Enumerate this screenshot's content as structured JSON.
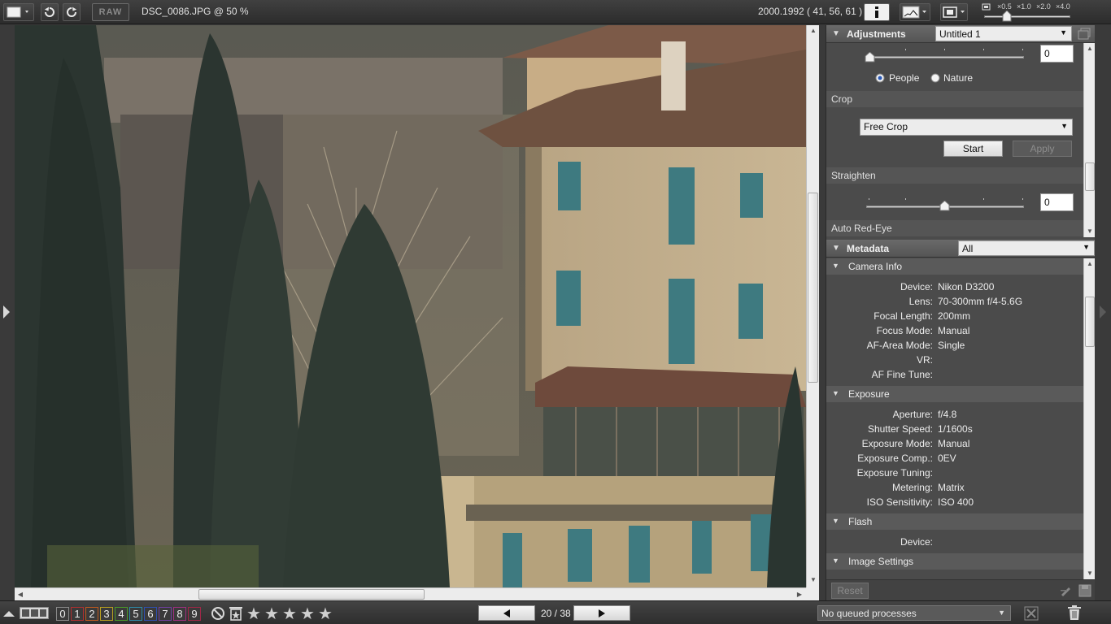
{
  "toolbar": {
    "raw_label": "RAW",
    "filename": "DSC_0086.JPG @ 50 %",
    "coords": "2000.1992 ( 41, 56, 61 )",
    "zoom_levels": [
      "×0.5",
      "×1.0",
      "×2.0",
      "×4.0"
    ]
  },
  "adjustments": {
    "title": "Adjustments",
    "preset": "Untitled 1",
    "slider_value": "0",
    "radio": [
      {
        "label": "People",
        "selected": true
      },
      {
        "label": "Nature",
        "selected": false
      }
    ],
    "crop_label": "Crop",
    "crop_mode": "Free Crop",
    "start_label": "Start",
    "apply_label": "Apply",
    "straighten_label": "Straighten",
    "straighten_value": "0",
    "red_eye_label": "Auto Red-Eye"
  },
  "metadata": {
    "title": "Metadata",
    "filter": "All",
    "camera_info": {
      "title": "Camera Info",
      "rows": [
        {
          "k": "Device:",
          "v": "Nikon D3200"
        },
        {
          "k": "Lens:",
          "v": "70-300mm f/4-5.6G"
        },
        {
          "k": "Focal Length:",
          "v": "200mm"
        },
        {
          "k": "Focus Mode:",
          "v": "Manual"
        },
        {
          "k": "AF-Area Mode:",
          "v": "Single"
        },
        {
          "k": "VR:",
          "v": ""
        },
        {
          "k": "AF Fine Tune:",
          "v": ""
        }
      ]
    },
    "exposure": {
      "title": "Exposure",
      "rows": [
        {
          "k": "Aperture:",
          "v": "f/4.8"
        },
        {
          "k": "Shutter Speed:",
          "v": "1/1600s"
        },
        {
          "k": "Exposure Mode:",
          "v": "Manual"
        },
        {
          "k": "Exposure Comp.:",
          "v": "0EV"
        },
        {
          "k": "Exposure Tuning:",
          "v": ""
        },
        {
          "k": "Metering:",
          "v": "Matrix"
        },
        {
          "k": "ISO Sensitivity:",
          "v": "ISO 400"
        }
      ]
    },
    "flash": {
      "title": "Flash",
      "rows": [
        {
          "k": "Device:",
          "v": ""
        }
      ]
    },
    "image_settings": {
      "title": "Image Settings"
    },
    "reset_label": "Reset"
  },
  "bottom": {
    "labels": [
      {
        "n": "0",
        "color": "#8a8a8a"
      },
      {
        "n": "1",
        "color": "#b03030"
      },
      {
        "n": "2",
        "color": "#c05a20"
      },
      {
        "n": "3",
        "color": "#b8a020"
      },
      {
        "n": "4",
        "color": "#4a9a2a"
      },
      {
        "n": "5",
        "color": "#2f8aa8"
      },
      {
        "n": "6",
        "color": "#3050b0"
      },
      {
        "n": "7",
        "color": "#7040a0"
      },
      {
        "n": "8",
        "color": "#a03080"
      },
      {
        "n": "9",
        "color": "#a02848"
      }
    ],
    "star_count": 5,
    "page_counter": "20 / 38",
    "queue_status": "No queued processes"
  }
}
